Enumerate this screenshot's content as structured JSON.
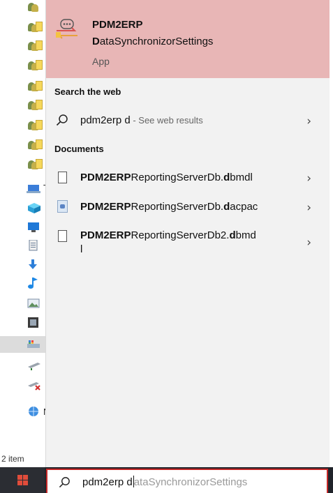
{
  "explorer": {
    "status_items": "2 item",
    "letters": {
      "t": "T",
      "n": "N"
    }
  },
  "best_match": {
    "title_line1": "PDM2ERP",
    "title_line2_bold": "D",
    "title_line2_rest": "ataSynchronizorSettings",
    "type": "App"
  },
  "web": {
    "header": "Search the web",
    "query": "pdm2erp d",
    "hint": " - See web results"
  },
  "documents": {
    "header": "Documents",
    "items": [
      {
        "bold1": "PDM2ERP",
        "mid": "ReportingServerDb.",
        "bold2": "d",
        "rest": "bmdl",
        "rest2": "",
        "icon": "document-icon"
      },
      {
        "bold1": "PDM2ERP",
        "mid": "ReportingServerDb.",
        "bold2": "d",
        "rest": "acpac",
        "rest2": "",
        "icon": "dacpac-icon"
      },
      {
        "bold1": "PDM2ERP",
        "mid": "ReportingServerDb2.",
        "bold2": "d",
        "rest": "bmd",
        "rest2": "l",
        "icon": "document-icon"
      }
    ]
  },
  "search_box": {
    "typed": "pdm2erp d",
    "suggestion": "ataSynchronizorSettings"
  },
  "colors": {
    "best_match_bg": "#e8b6b6",
    "panel_bg": "#f2f2f2",
    "taskbar": "#20232a",
    "search_border": "#c62828",
    "windows_logo": "#e04c3b"
  },
  "icons": [
    "search-icon",
    "chevron-right-icon",
    "document-icon",
    "dacpac-icon",
    "app-sync-icon",
    "windows-logo-icon"
  ]
}
